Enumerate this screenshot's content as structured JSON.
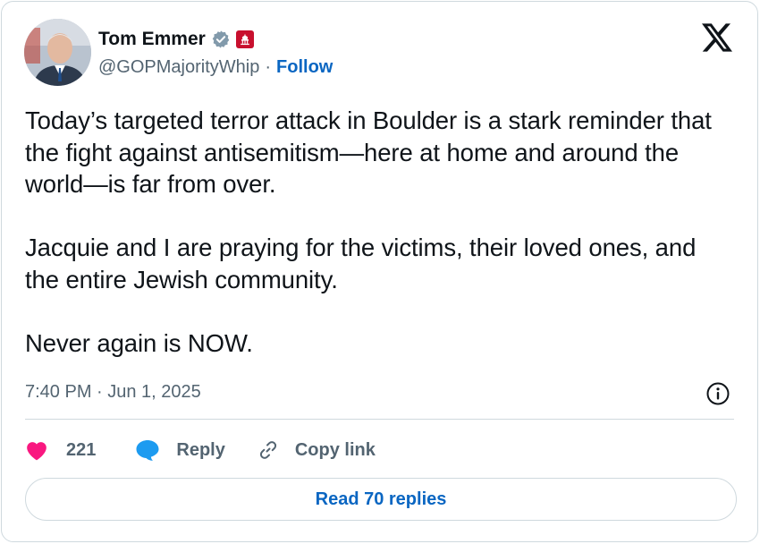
{
  "author": {
    "display_name": "Tom Emmer",
    "handle": "@GOPMajorityWhip",
    "separator": "·",
    "follow_label": "Follow"
  },
  "tweet": {
    "paragraphs": [
      "Today’s targeted terror attack in Boulder is a stark reminder that the fight against antisemitism—here at home and around the world—is far from over.",
      "Jacquie and I are praying for the victims, their loved ones, and the entire Jewish community.",
      "Never again is NOW."
    ],
    "timestamp": "7:40 PM · Jun 1, 2025"
  },
  "actions": {
    "like_count": "221",
    "reply_label": "Reply",
    "copy_link_label": "Copy link"
  },
  "read_replies_label": "Read 70 replies",
  "icons": {
    "brand": "x-logo-icon",
    "verified": "verified-badge-icon",
    "affiliation": "capitol-affiliation-icon",
    "like": "heart-icon",
    "reply": "speech-bubble-icon",
    "copy": "link-icon",
    "info": "info-icon"
  },
  "colors": {
    "link_blue": "#1d9bf0",
    "heart_pink": "#f91880",
    "affiliation_red": "#c8102e",
    "secondary_text": "#536471",
    "border": "#cfd9de"
  }
}
